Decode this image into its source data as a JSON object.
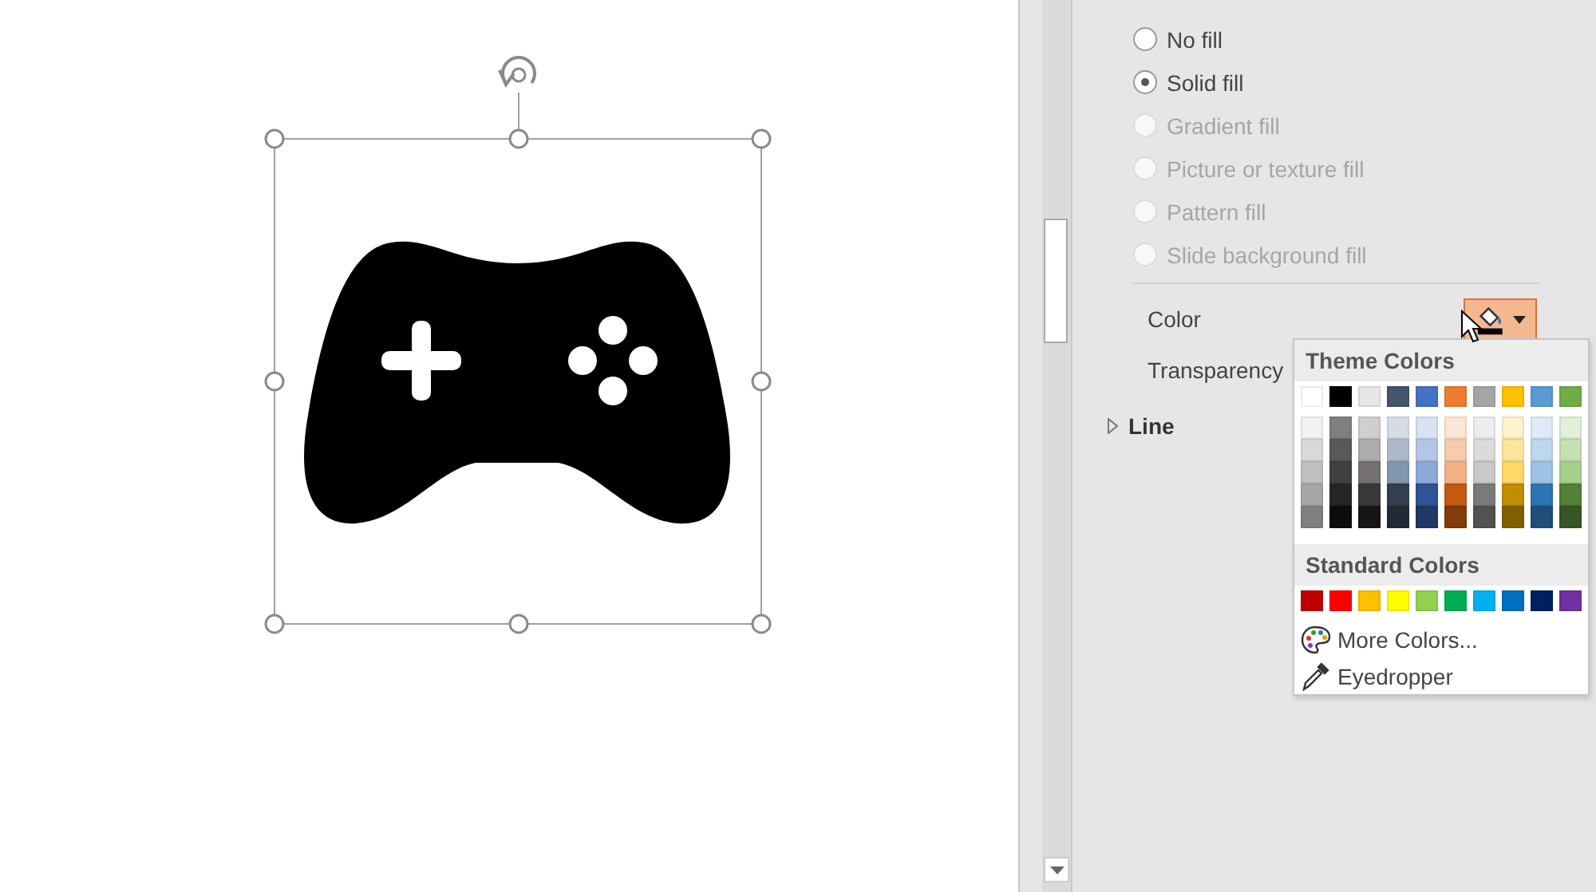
{
  "canvas": {
    "shape_selected": true
  },
  "panel": {
    "fill_options": [
      {
        "label": "No fill",
        "selected": false,
        "disabled": false
      },
      {
        "label": "Solid fill",
        "selected": true,
        "disabled": false
      },
      {
        "label": "Gradient fill",
        "selected": false,
        "disabled": true
      },
      {
        "label": "Picture or texture fill",
        "selected": false,
        "disabled": true
      },
      {
        "label": "Pattern fill",
        "selected": false,
        "disabled": true
      },
      {
        "label": "Slide background fill",
        "selected": false,
        "disabled": true
      }
    ],
    "color": {
      "label": "Color"
    },
    "color_button": {
      "open": true,
      "color": "#000000"
    },
    "transparency": {
      "label": "Transparency"
    },
    "line": {
      "label": "Line",
      "expanded": false
    }
  },
  "color_menu": {
    "theme_title": "Theme Colors",
    "theme_top": [
      {
        "color": "#ffffff"
      },
      {
        "color": "#000000"
      },
      {
        "color": "#e7e6e6"
      },
      {
        "color": "#44546a"
      },
      {
        "color": "#4472c4"
      },
      {
        "color": "#ed7d31"
      },
      {
        "color": "#a5a5a5"
      },
      {
        "color": "#ffc000"
      },
      {
        "color": "#5b9bd5"
      },
      {
        "color": "#70ad47"
      }
    ],
    "theme_shades": [
      {
        "swatches": [
          {
            "color": "#f2f2f2"
          },
          {
            "color": "#7f7f7f"
          },
          {
            "color": "#d0cece"
          },
          {
            "color": "#d6dce4"
          },
          {
            "color": "#d9e2f3"
          },
          {
            "color": "#fbe5d5"
          },
          {
            "color": "#ededed"
          },
          {
            "color": "#fff2cc"
          },
          {
            "color": "#deebf6"
          },
          {
            "color": "#e2efd9"
          }
        ]
      },
      {
        "swatches": [
          {
            "color": "#d9d9d9"
          },
          {
            "color": "#595959"
          },
          {
            "color": "#aeabab"
          },
          {
            "color": "#adb9ca"
          },
          {
            "color": "#b4c6e7"
          },
          {
            "color": "#f7cbac"
          },
          {
            "color": "#dbdbdb"
          },
          {
            "color": "#ffe599"
          },
          {
            "color": "#bdd7ee"
          },
          {
            "color": "#c5e0b3"
          }
        ]
      },
      {
        "swatches": [
          {
            "color": "#bfbfbf"
          },
          {
            "color": "#404040"
          },
          {
            "color": "#757171"
          },
          {
            "color": "#8497b0"
          },
          {
            "color": "#8eaadb"
          },
          {
            "color": "#f4b183"
          },
          {
            "color": "#c9c9c9"
          },
          {
            "color": "#ffd966"
          },
          {
            "color": "#9dc3e6"
          },
          {
            "color": "#a8d08d"
          }
        ]
      },
      {
        "swatches": [
          {
            "color": "#a6a6a6"
          },
          {
            "color": "#262626"
          },
          {
            "color": "#3a3838"
          },
          {
            "color": "#333f4f"
          },
          {
            "color": "#2f5496"
          },
          {
            "color": "#c55a11"
          },
          {
            "color": "#7b7b7b"
          },
          {
            "color": "#bf8f00"
          },
          {
            "color": "#2e75b5"
          },
          {
            "color": "#538135"
          }
        ]
      },
      {
        "swatches": [
          {
            "color": "#808080"
          },
          {
            "color": "#0d0d0d"
          },
          {
            "color": "#171616"
          },
          {
            "color": "#222a35"
          },
          {
            "color": "#1f3864"
          },
          {
            "color": "#833c0b"
          },
          {
            "color": "#525252"
          },
          {
            "color": "#7f6000"
          },
          {
            "color": "#1f4e79"
          },
          {
            "color": "#375623"
          }
        ]
      }
    ],
    "standard_title": "Standard Colors",
    "standard": [
      {
        "color": "#c00000"
      },
      {
        "color": "#ff0000"
      },
      {
        "color": "#ffc000"
      },
      {
        "color": "#ffff00"
      },
      {
        "color": "#92d050"
      },
      {
        "color": "#00b050"
      },
      {
        "color": "#00b0f0"
      },
      {
        "color": "#0070c0"
      },
      {
        "color": "#002060"
      },
      {
        "color": "#7030a0"
      }
    ],
    "items": [
      {
        "label": "More Colors...",
        "kind": "palette"
      },
      {
        "label": "Eyedropper",
        "kind": "eyedropper"
      }
    ]
  }
}
